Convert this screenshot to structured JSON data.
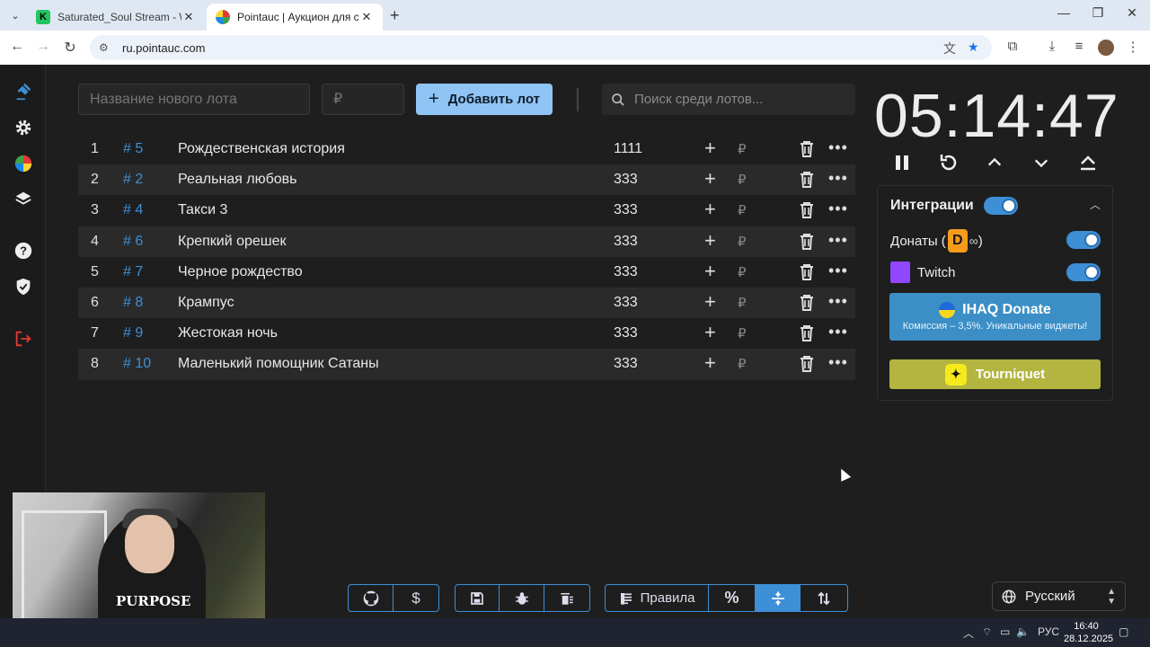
{
  "browser": {
    "tabs": [
      {
        "title": "Saturated_Soul Stream - Watch",
        "active": false
      },
      {
        "title": "Pointauc | Аукцион для стримеров",
        "active": true
      }
    ],
    "url": "ru.pointauc.com"
  },
  "form": {
    "lot_name_placeholder": "Название нового лота",
    "price_placeholder": "₽",
    "add_label": "Добавить лот",
    "search_placeholder": "Поиск среди лотов..."
  },
  "lots": [
    {
      "n": "1",
      "id": "# 5",
      "name": "Рождественская история",
      "amount": "1111",
      "currency": "₽"
    },
    {
      "n": "2",
      "id": "# 2",
      "name": "Реальная любовь",
      "amount": "333",
      "currency": "₽"
    },
    {
      "n": "3",
      "id": "# 4",
      "name": "Такси 3",
      "amount": "333",
      "currency": "₽"
    },
    {
      "n": "4",
      "id": "# 6",
      "name": "Крепкий орешек",
      "amount": "333",
      "currency": "₽"
    },
    {
      "n": "5",
      "id": "# 7",
      "name": "Черное рождество",
      "amount": "333",
      "currency": "₽"
    },
    {
      "n": "6",
      "id": "# 8",
      "name": "Крампус",
      "amount": "333",
      "currency": "₽"
    },
    {
      "n": "7",
      "id": "# 9",
      "name": "Жестокая ночь",
      "amount": "333",
      "currency": "₽"
    },
    {
      "n": "8",
      "id": "# 10",
      "name": "Маленький помощник Сатаны",
      "amount": "333",
      "currency": "₽"
    }
  ],
  "timer": {
    "value": "05:14:47"
  },
  "integrations": {
    "title": "Интеграции",
    "donations_label": "Донаты (",
    "donations_suffix": ")",
    "twitch_label": "Twitch",
    "ihaq_title": "IHAQ Donate",
    "ihaq_sub": "Комиссия – 3,5%. Уникальные виджеты!",
    "tourniquet_label": "Tourniquet"
  },
  "toolbar": {
    "rules_label": "Правила",
    "percent_label": "%"
  },
  "language": {
    "selected": "Русский"
  },
  "webcam": {
    "shirt_text": "PURPOSE"
  },
  "taskbar": {
    "lang": "РУС",
    "time": "16:40",
    "date": "28.12.2025"
  },
  "colors": {
    "accent": "#3d8fd6",
    "add_button": "#8fc4f5",
    "ihaq": "#3b8fc6",
    "tourniquet": "#b3b540"
  }
}
